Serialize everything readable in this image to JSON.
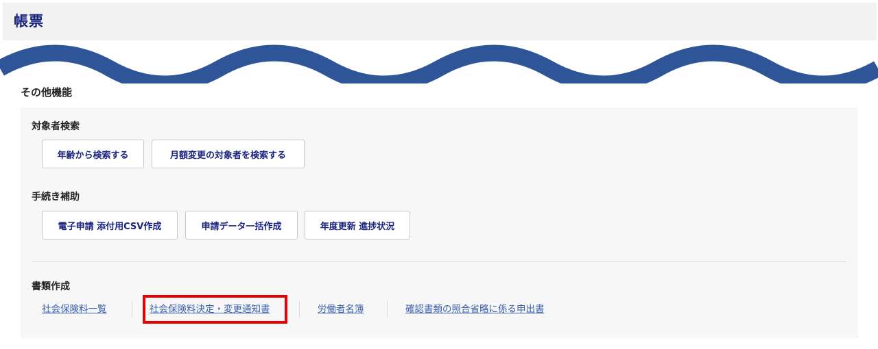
{
  "header": {
    "title": "帳票"
  },
  "section": {
    "title": "その他機能"
  },
  "groups": {
    "search": {
      "title": "対象者検索",
      "buttons": [
        "年齢から検索する",
        "月額変更の対象者を検索する"
      ]
    },
    "procedure": {
      "title": "手続き補助",
      "buttons": [
        "電子申請 添付用CSV作成",
        "申請データ一括作成",
        "年度更新 進捗状況"
      ]
    },
    "documents": {
      "title": "書類作成",
      "links": [
        "社会保険料一覧",
        "社会保険料決定・変更通知書",
        "労働者名簿",
        "確認書類の照合省略に係る申出書"
      ]
    }
  },
  "colors": {
    "wave": "#2e5597",
    "highlight": "#e60000",
    "link": "#3a5ea8",
    "title": "#1a237e"
  }
}
